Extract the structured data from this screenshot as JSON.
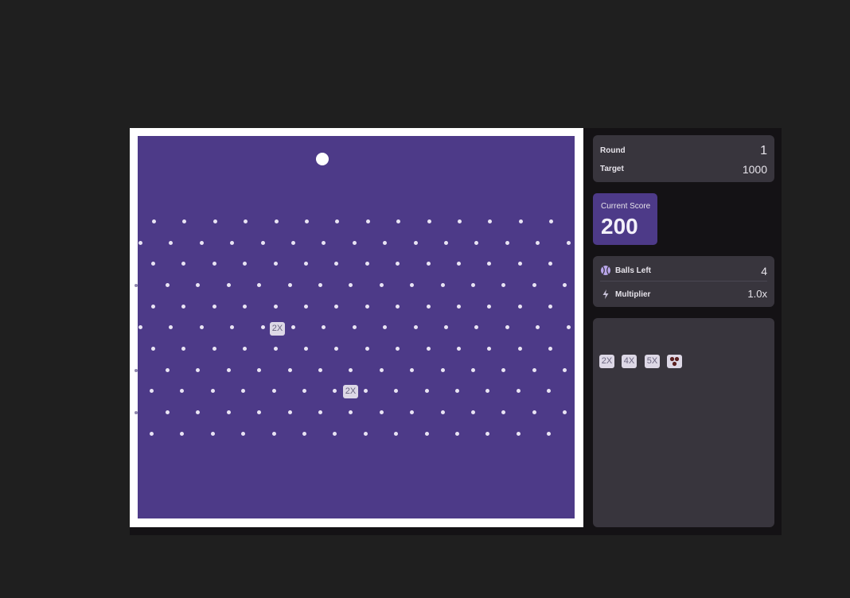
{
  "board": {
    "multipliers": [
      {
        "label": "2X"
      },
      {
        "label": "2X"
      }
    ]
  },
  "stats": {
    "round_label": "Round",
    "round_value": "1",
    "target_label": "Target",
    "target_value": "1000"
  },
  "score": {
    "label": "Current Score",
    "value": "200"
  },
  "status": {
    "balls_label": "Balls Left",
    "balls_value": "4",
    "multiplier_label": "Multiplier",
    "multiplier_value": "1.0x",
    "balls_icon": "ball-icon",
    "multiplier_icon": "lightning-icon"
  },
  "inventory": {
    "items": [
      {
        "label": "2X"
      },
      {
        "label": "4X"
      },
      {
        "label": "5X"
      },
      {
        "label": "",
        "icon": "dice-icon"
      }
    ]
  },
  "colors": {
    "board": "#4d3a88",
    "accent": "#4d3a88",
    "panel": "#38353d"
  }
}
